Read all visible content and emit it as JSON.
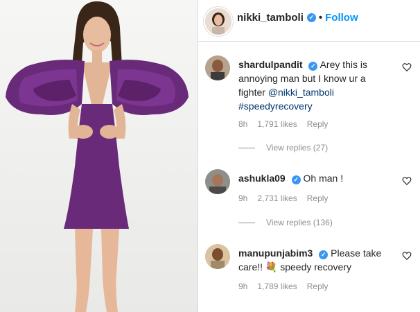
{
  "post": {
    "username": "nikki_tamboli",
    "separator": "•",
    "follow_label": "Follow"
  },
  "comments": [
    {
      "username": "shardulpandit",
      "text_before": "Arey this is annoying man but I know ur a fighter ",
      "mention": "@nikki_tamboli",
      "hashtag": "#speedyrecovery",
      "time": "8h",
      "likes": "1,791 likes",
      "reply": "Reply",
      "view_replies": "View replies (27)"
    },
    {
      "username": "ashukla09",
      "text": "Oh man !",
      "time": "9h",
      "likes": "2,731 likes",
      "reply": "Reply",
      "view_replies": "View replies (136)"
    },
    {
      "username": "manupunjabim3",
      "text_before": "Please take care!! ",
      "emoji": "💐",
      "text_after": " speedy recovery",
      "time": "9h",
      "likes": "1,789 likes",
      "reply": "Reply"
    }
  ],
  "colors": {
    "link": "#0095f6",
    "verified": "#3897f0",
    "dress": "#6a2a7a",
    "meta": "#8e8e8e"
  }
}
